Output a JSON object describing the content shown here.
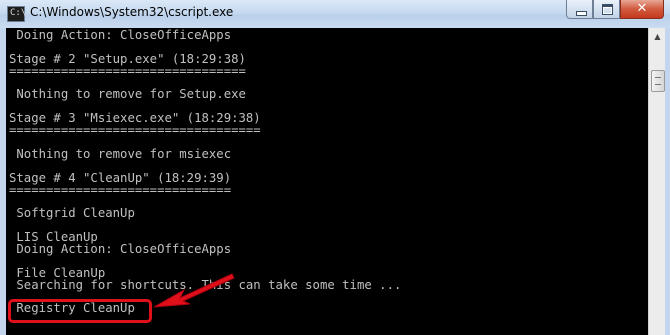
{
  "window": {
    "title": "C:\\Windows\\System32\\cscript.exe",
    "icon_text": "C:\\"
  },
  "controls": {
    "close_label": "✕"
  },
  "console": {
    "lines": [
      " Doing Action: CloseOfficeApps",
      "",
      "Stage # 2 \"Setup.exe\" (18:29:38)",
      "================================",
      "",
      " Nothing to remove for Setup.exe",
      "",
      "Stage # 3 \"Msiexec.exe\" (18:29:38)",
      "==================================",
      "",
      " Nothing to remove for msiexec",
      "",
      "Stage # 4 \"CleanUp\" (18:29:39)",
      "==============================",
      "",
      " Softgrid CleanUp",
      "",
      " LIS CleanUp",
      " Doing Action: CloseOfficeApps",
      "",
      " File CleanUp",
      " Searching for shortcuts. This can take some time ...",
      "",
      " Registry CleanUp"
    ]
  },
  "colors": {
    "console_bg": "#000000",
    "console_text": "#c0c0c0",
    "annotation": "#e0101a"
  }
}
